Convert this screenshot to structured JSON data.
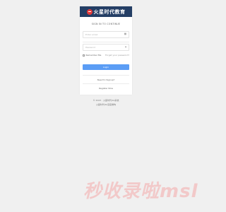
{
  "brand": {
    "name": "火星时代教育",
    "logo_icon": "brand-logo-icon"
  },
  "form": {
    "title": "SIGN IN TO CONTINUE",
    "username_placeholder": "Enter email",
    "username_icon": "user-card-icon",
    "password_placeholder": "Password",
    "password_icon": "lock-icon",
    "remember_label": "Remember Me",
    "forgot_label": "Forget your password?",
    "login_label": "Login",
    "signup_question": "Need to Signup?",
    "register_label": "Register Now"
  },
  "footer": {
    "line1": "© 2023 · 火星时代OA系统",
    "line2": "火星时代OA深度重构"
  },
  "watermark": {
    "text": "秒收录啦msl"
  },
  "colors": {
    "brand_bar": "#243e65",
    "primary_button": "#5b9df5",
    "background": "#f0f0f0",
    "watermark": "#f2c9c9"
  }
}
